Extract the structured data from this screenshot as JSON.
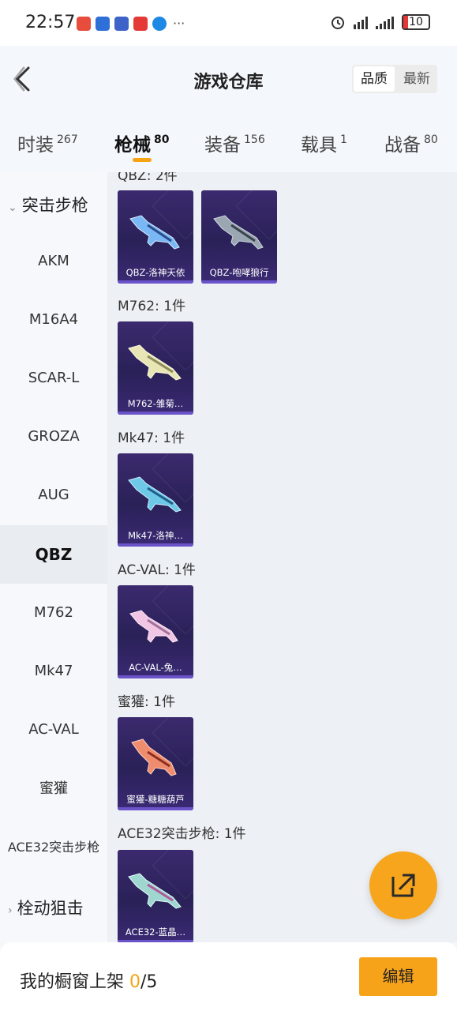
{
  "status_bar": {
    "time": "22:57",
    "battery": "10",
    "more": "···"
  },
  "header": {
    "title": "游戏仓库",
    "sort_options": [
      "品质",
      "最新"
    ]
  },
  "tabs": [
    {
      "label": "时装",
      "count": "267"
    },
    {
      "label": "枪械",
      "count": "80"
    },
    {
      "label": "装备",
      "count": "156"
    },
    {
      "label": "载具",
      "count": "1"
    },
    {
      "label": "战备",
      "count": "80"
    }
  ],
  "sidebar": {
    "group_open": "突击步枪",
    "items": [
      "AKM",
      "M16A4",
      "SCAR-L",
      "GROZA",
      "AUG",
      "QBZ",
      "M762",
      "Mk47",
      "AC-VAL",
      "蜜獾",
      "ACE32突击步枪"
    ],
    "active": "QBZ",
    "group_closed": "栓动狙击"
  },
  "content": {
    "sections": [
      {
        "title": "QBZ: 2件",
        "items": [
          "QBZ-洛神天依",
          "QBZ-咆哮狼行"
        ]
      },
      {
        "title": "M762: 1件",
        "items": [
          "M762-雏菊…"
        ]
      },
      {
        "title": "Mk47: 1件",
        "items": [
          "Mk47-洛神…"
        ]
      },
      {
        "title": "AC-VAL: 1件",
        "items": [
          "AC-VAL-兔…"
        ]
      },
      {
        "title": "蜜獾: 1件",
        "items": [
          "蜜獾-糖糖葫芦"
        ]
      },
      {
        "title": "ACE32突击步枪: 1件",
        "items": [
          "ACE32-蓝晶…"
        ]
      }
    ]
  },
  "footer": {
    "label": "我的橱窗上架",
    "count": "0",
    "total": "/5",
    "edit_button": "编辑"
  },
  "colors": {
    "accent": "#f7a51c",
    "card_bg": "#2a2158"
  }
}
